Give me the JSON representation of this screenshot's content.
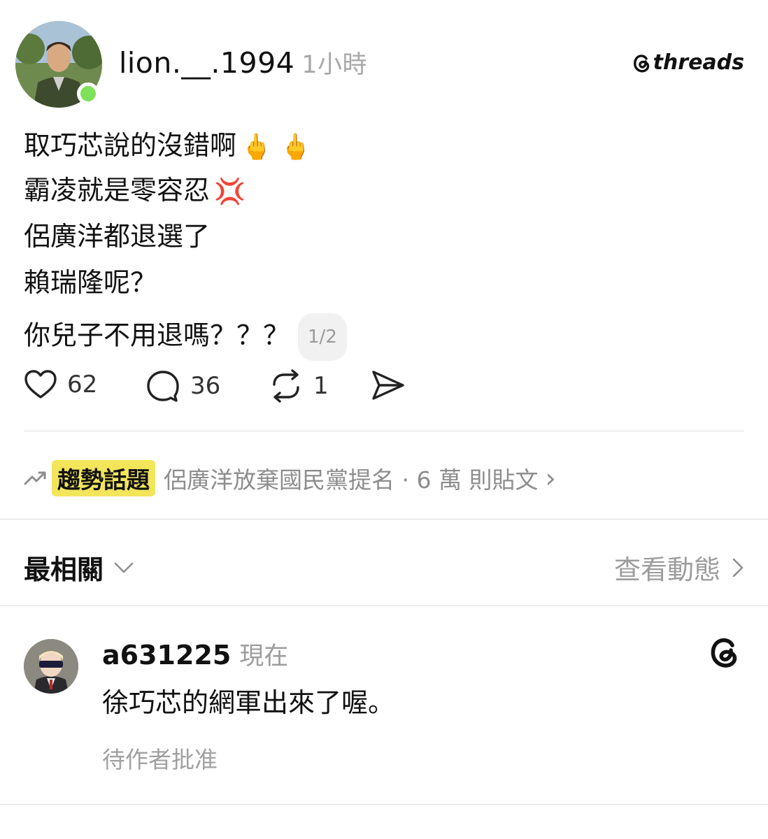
{
  "post": {
    "username": "lion.__.1994",
    "time": "1小時",
    "brand": "threads",
    "lines": [
      "取巧芯說的沒錯啊",
      "霸凌就是零容忍",
      "侶廣洋都退選了",
      "賴瑞隆呢？",
      "你兒子不用退嗎？？？"
    ],
    "emoji_line1": "🖕 🖕",
    "emoji_line2": "💢",
    "page_indicator": "1/2",
    "likes": "62",
    "comments": "36",
    "reposts": "1"
  },
  "trending": {
    "badge": "趨勢話題",
    "text": "侶廣洋放棄國民黨提名 · 6 萬 則貼文",
    "chevron": "›"
  },
  "replies_header": {
    "sort_label": "最相關",
    "view_activity": "查看動態"
  },
  "comment": {
    "username": "a631225",
    "time": "現在",
    "text": "徐巧芯的網軍出來了喔。",
    "status": "待作者批准"
  },
  "colors": {
    "online": "#7fe05a",
    "trend_badge": "#f3e55a",
    "muted": "#9c9c9c"
  }
}
